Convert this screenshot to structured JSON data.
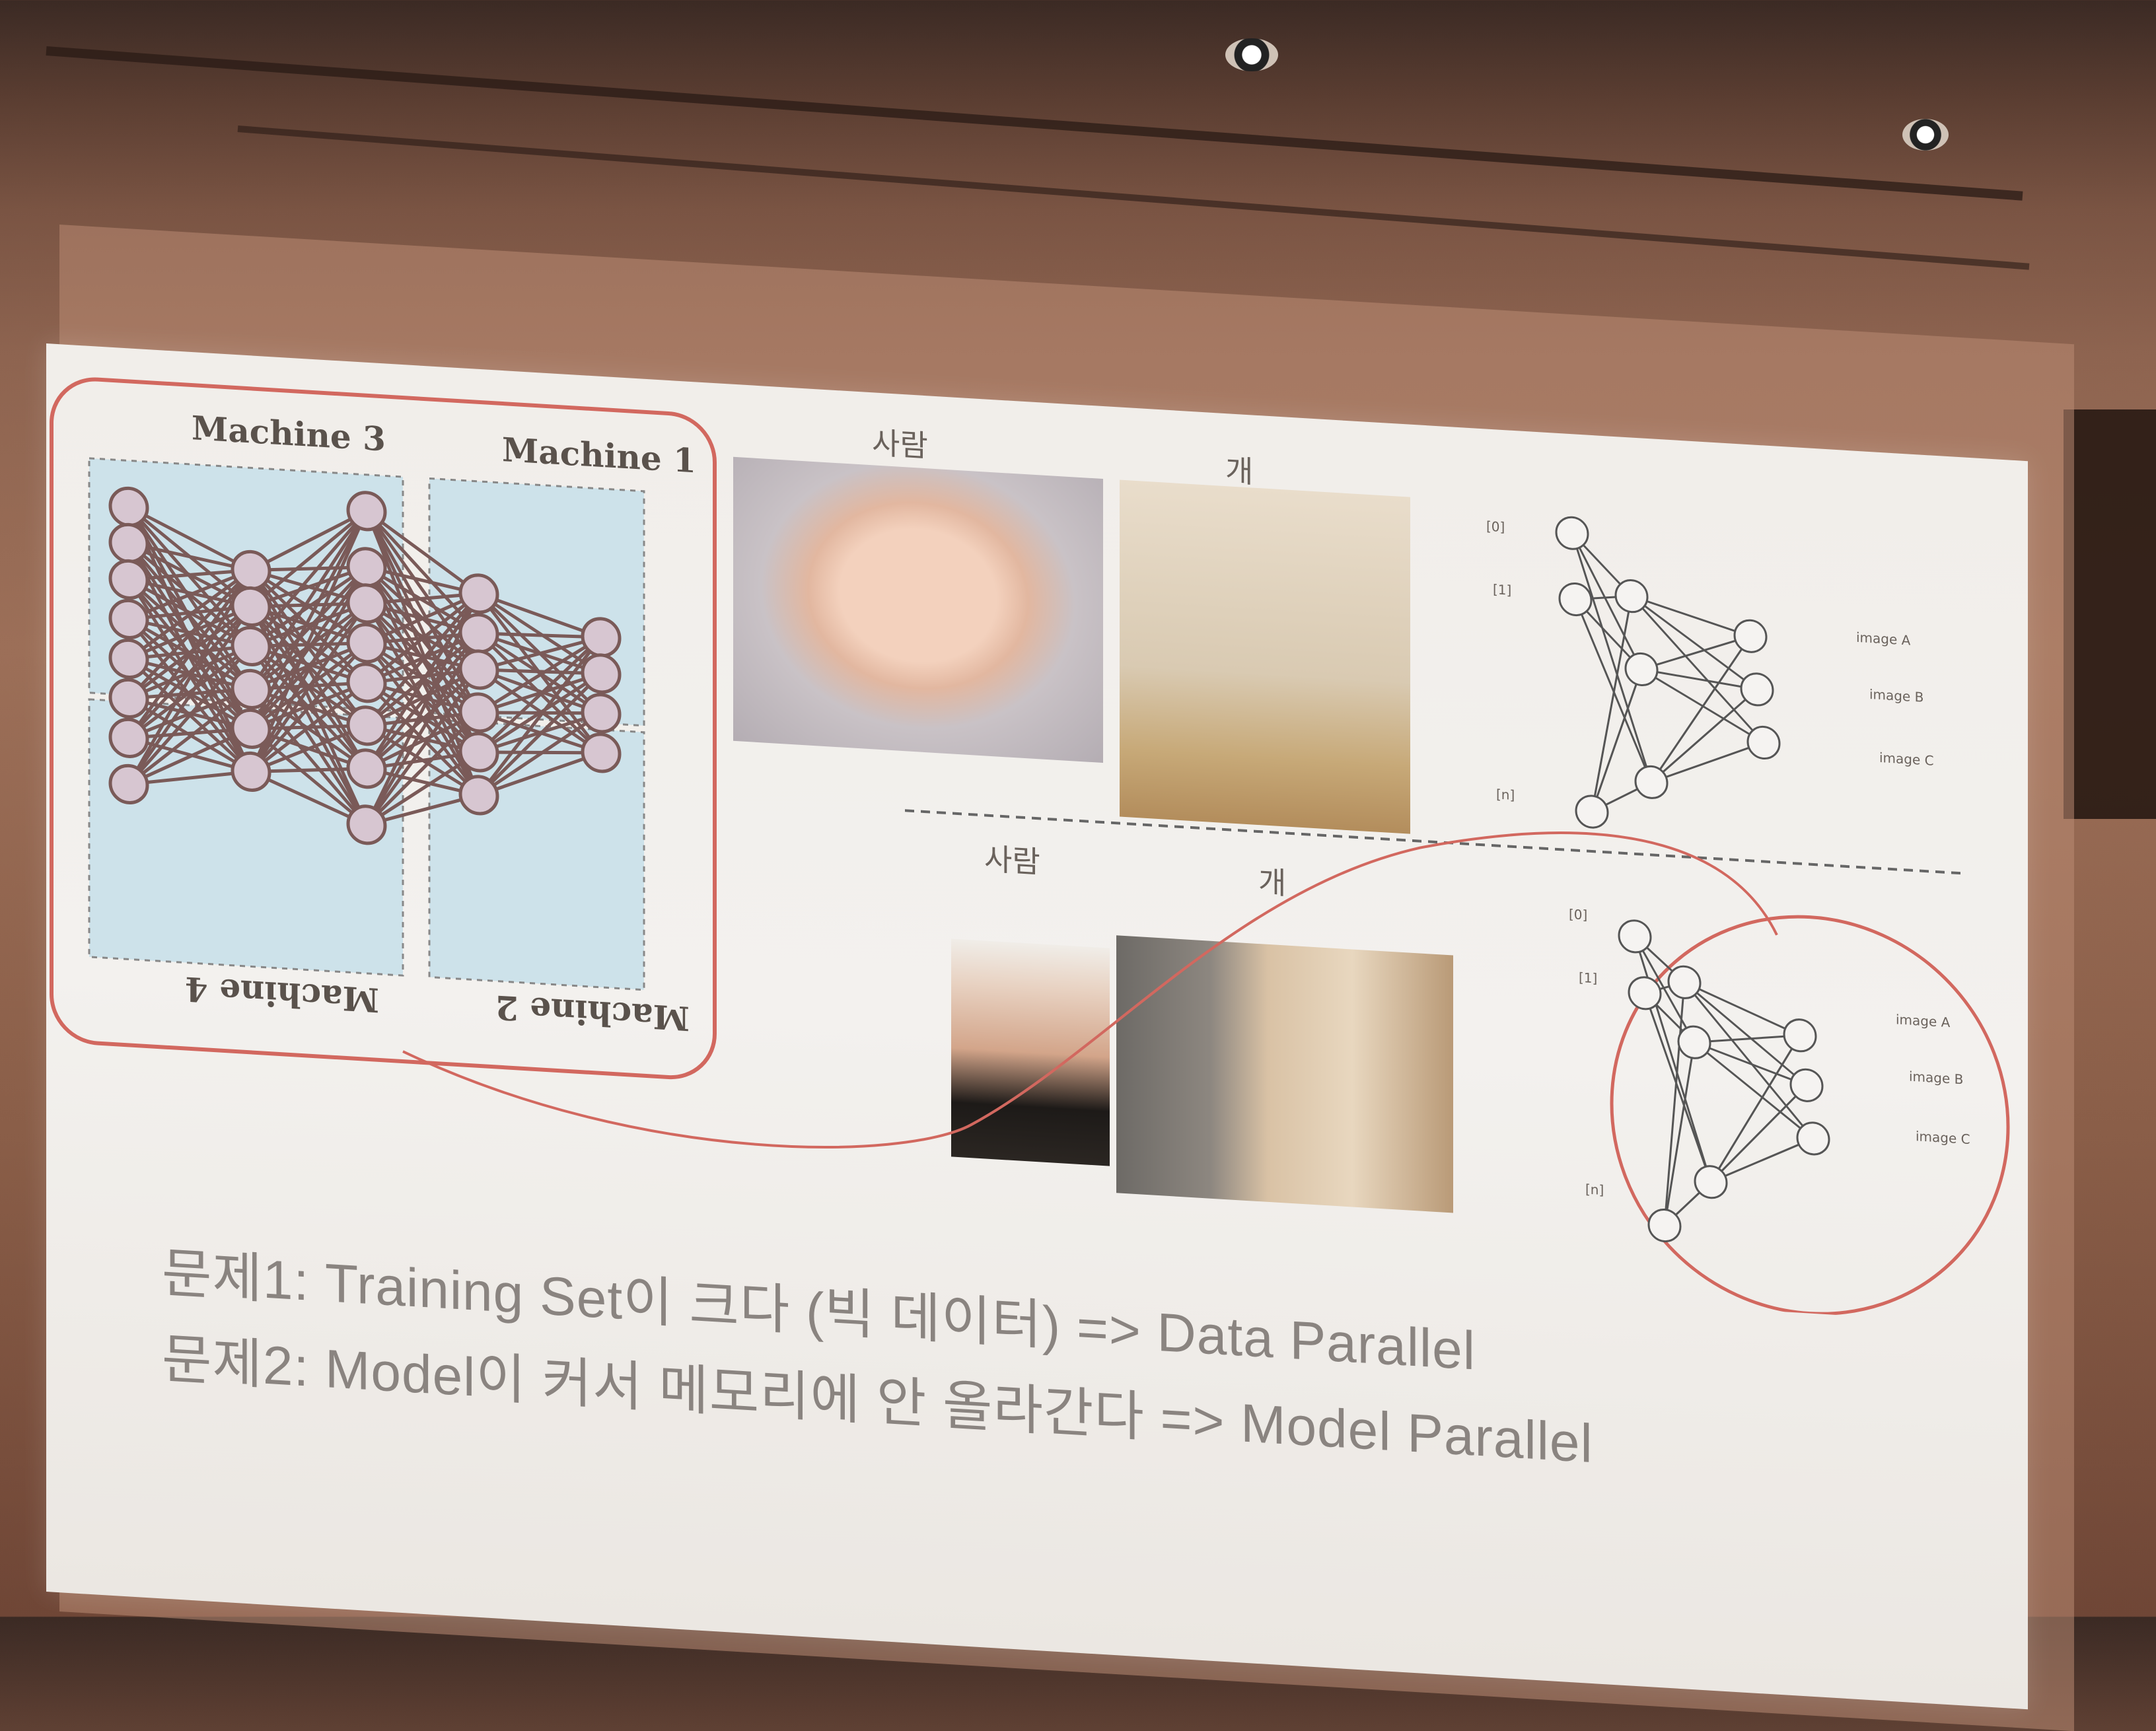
{
  "slide": {
    "machines": {
      "top_left": "Machine 3",
      "top_right": "Machine 1",
      "bottom_left": "Machine 4",
      "bottom_right": "Machine 2"
    },
    "data_parallel": {
      "label_person": "사람",
      "label_dog": "개"
    },
    "model_parallel": {
      "label_person": "사람",
      "label_dog": "개"
    },
    "network_top": {
      "inputs": [
        "[0]",
        "[1]",
        "[n]"
      ],
      "outputs": [
        "image A",
        "image B",
        "image C"
      ]
    },
    "network_bottom": {
      "inputs": [
        "[0]",
        "[1]",
        "[n]"
      ],
      "outputs": [
        "image A",
        "image B",
        "image C"
      ]
    },
    "problems": {
      "line1": "문제1: Training Set이 크다 (빅 데이터) => Data Parallel",
      "line2": "문제2: Model이 커서 메모리에 안 올라간다 => Model Parallel"
    }
  },
  "colors": {
    "accent_red": "#d2685f",
    "panel_blue": "#cde2ea",
    "line_brown": "#7a5a58",
    "text_gray": "#8a8480"
  }
}
